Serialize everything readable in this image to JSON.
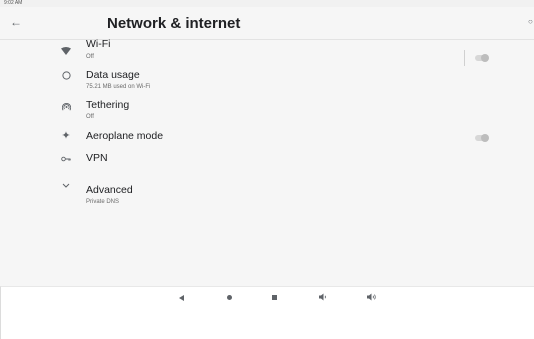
{
  "status_bar": {
    "time": "9:02 AM"
  },
  "header": {
    "title": "Network & internet"
  },
  "items": [
    {
      "label": "Wi-Fi",
      "sub": "Off"
    },
    {
      "label": "Data usage",
      "sub": "75.21 MB used on Wi-Fi"
    },
    {
      "label": "Tethering",
      "sub": "Off"
    },
    {
      "label": "Aeroplane mode"
    },
    {
      "label": "VPN"
    },
    {
      "label": "Advanced",
      "sub": "Private DNS"
    }
  ],
  "toggles": {
    "wifi": "off",
    "aeroplane_mode": "off"
  },
  "icons": {
    "back": "arrow-left-icon",
    "wifi": "wifi-icon",
    "data_usage": "data-usage-icon",
    "tethering": "hotspot-icon",
    "aeroplane": "airplane-icon",
    "vpn": "vpn-key-icon",
    "advanced": "chevron-down-icon",
    "nav_back": "nav-back-icon",
    "nav_home": "nav-home-icon",
    "nav_recents": "nav-recents-icon",
    "volume_down": "volume-down-icon",
    "volume_up": "volume-up-icon"
  },
  "colors": {
    "background": "#f6f6f6",
    "text": "#202124",
    "secondary_text": "#6b6b6b",
    "icon": "#5f6368",
    "toggle_off": "#bdbdbd"
  }
}
